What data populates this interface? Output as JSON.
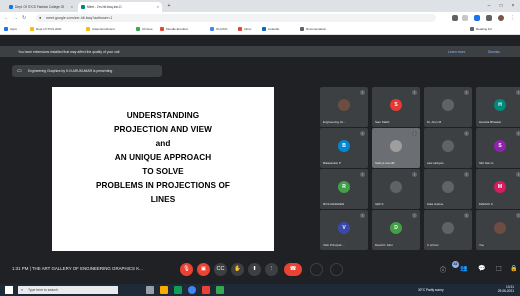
{
  "browser": {
    "tabs": [
      {
        "title": "Dept. Of IT/CS Fashion College Of",
        "color": "#1a73e8",
        "active": false
      },
      {
        "title": "Meet - 2rn-hif-kwq-tnn-D",
        "color": "#00897b",
        "active": true
      }
    ],
    "new_tab": "+",
    "url": "meet.google.com/zer-hif-kwq?authuser=1",
    "bookmarks": [
      "Apps",
      "Dept of IT/CS 2021",
      "Class Enrollment",
      "Chrome",
      "Moodle Enrolled",
      "OU-FDC",
      "Inbox",
      "LinkedIn",
      "Documentation",
      "Reading list"
    ]
  },
  "notice": {
    "text": "You have extensions installed that may affect the quality of your call",
    "learn_more": "Learn more",
    "dismiss": "Dismiss"
  },
  "presenting": "Engineering Graphics by K.N.ARUKUMAR is presenting",
  "slide": {
    "lines": [
      "UNDERSTANDING",
      "PROJECTION AND VIEW",
      "and",
      "AN UNIQUE APPROACH",
      "TO SOLVE",
      "PROBLEMS IN PROJECTIONS OF",
      "LINES"
    ]
  },
  "participants": [
    {
      "name": "Engineering Gr...",
      "color": "#6d4c41",
      "initial": ""
    },
    {
      "name": "Sam Mathi",
      "color": "#e53935",
      "initial": "S"
    },
    {
      "name": "Dr. Arun M",
      "color": "#5f6368",
      "initial": ""
    },
    {
      "name": "Hansha Bhaskar",
      "color": "#00897b",
      "initial": "H"
    },
    {
      "name": "Balasankar P",
      "color": "#0288d1",
      "initial": "B"
    },
    {
      "name": "Sathya Gandhi",
      "color": "#9e9e9e",
      "initial": ""
    },
    {
      "name": "sasi sathyan",
      "color": "#5f6368",
      "initial": ""
    },
    {
      "name": "Sibi Dan G",
      "color": "#8e24aa",
      "initial": "S"
    },
    {
      "name": "RCS-MADHIEN",
      "color": "#43a047",
      "initial": "R"
    },
    {
      "name": "Ajith K",
      "color": "#5f6368",
      "initial": ""
    },
    {
      "name": "Kala Justine",
      "color": "#5f6368",
      "initial": ""
    },
    {
      "name": "MADHU C",
      "color": "#d81b60",
      "initial": "M"
    },
    {
      "name": "Vidu Principal ...",
      "color": "#3949ab",
      "initial": "V"
    },
    {
      "name": "David K John",
      "color": "#43a047",
      "initial": "D"
    },
    {
      "name": "C sriram",
      "color": "#5f6368",
      "initial": ""
    },
    {
      "name": "You",
      "color": "#6d4c41",
      "initial": ""
    }
  ],
  "meeting": {
    "info": "1:31 PM  |  THE ART GALLERY OF ENGINEERING GRAPHICS K...",
    "participant_count": "42"
  },
  "taskbar": {
    "search_placeholder": "Type here to search",
    "weather": "30°C Partly sunny",
    "time": "13:31",
    "date": "29-06-2021"
  },
  "colors": {
    "end_call": "#ea4335",
    "meet_bg": "#202124",
    "tile_bg": "#3c4043"
  }
}
